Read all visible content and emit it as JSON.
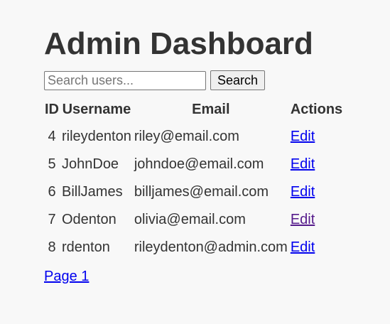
{
  "page": {
    "title": "Admin Dashboard"
  },
  "search": {
    "placeholder": "Search users...",
    "value": "",
    "button_label": "Search"
  },
  "table": {
    "headers": {
      "id": "ID",
      "username": "Username",
      "email": "Email",
      "actions": "Actions"
    },
    "rows": [
      {
        "id": "4",
        "username": "rileydenton",
        "email": "riley@email.com",
        "action": "Edit"
      },
      {
        "id": "5",
        "username": "JohnDoe",
        "email": "johndoe@email.com",
        "action": "Edit"
      },
      {
        "id": "6",
        "username": "BillJames",
        "email": "billjames@email.com",
        "action": "Edit"
      },
      {
        "id": "7",
        "username": "Odenton",
        "email": "olivia@email.com",
        "action": "Edit"
      },
      {
        "id": "8",
        "username": "rdenton",
        "email": "rileydenton@admin.com",
        "action": "Edit"
      }
    ]
  },
  "pagination": {
    "label": "Page 1"
  },
  "colors": {
    "background": "#f8f8f8",
    "text": "#333333",
    "link": "#0000ee",
    "visited_link": "#551a8b"
  }
}
